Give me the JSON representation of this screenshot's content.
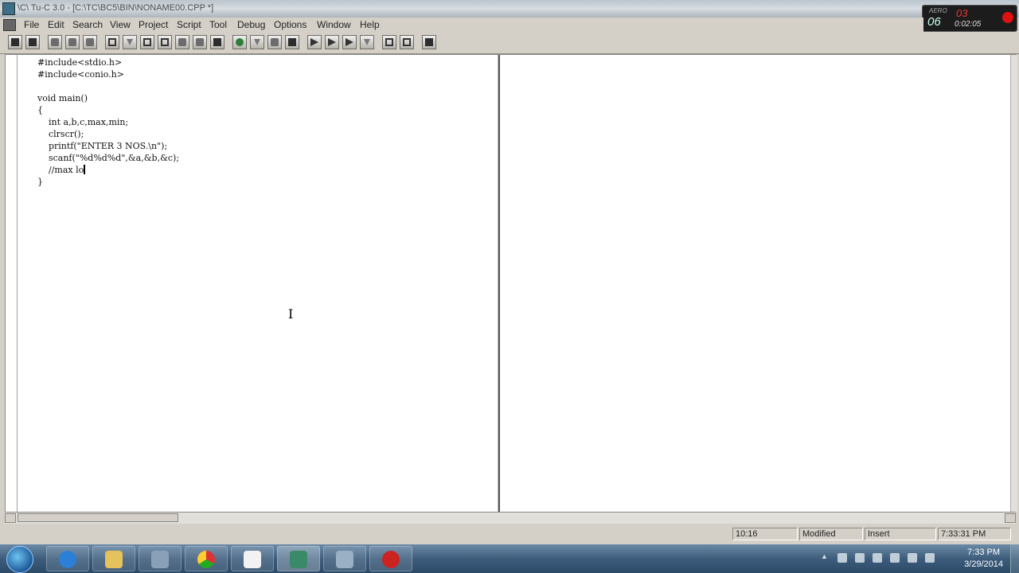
{
  "window": {
    "title": "\\C\\ Tu-C 3.0 - [C:\\TC\\BC5\\BIN\\NONAME00.CPP *]"
  },
  "recorder": {
    "aero": "AERO",
    "minutes": "06",
    "seconds": "03",
    "elapsed": "0:02:05"
  },
  "menu": [
    "File",
    "Edit",
    "Search",
    "View",
    "Project",
    "Script",
    "Tool",
    "Debug",
    "Options",
    "Window",
    "Help"
  ],
  "editor": {
    "code_lines": [
      "#include<stdio.h>",
      "#include<conio.h>",
      "",
      "void main()",
      "{",
      "    int a,b,c,max,min;",
      "    clrscr();",
      "    printf(\"ENTER 3 NOS.\\n\");",
      "    scanf(\"%d%d%d\",&a,&b,&c);",
      "    //max lo",
      "}"
    ]
  },
  "statusbar": {
    "position": "10:16",
    "modified": "Modified",
    "mode": "Insert",
    "time": "7:33:31 PM"
  },
  "taskbar": {
    "clock_time": "7:33 PM",
    "clock_date": "3/29/2014",
    "apps": [
      "internet-explorer",
      "file-explorer",
      "app-window",
      "chrome",
      "media-player",
      "c-compiler",
      "app-generic",
      "recorder"
    ]
  }
}
